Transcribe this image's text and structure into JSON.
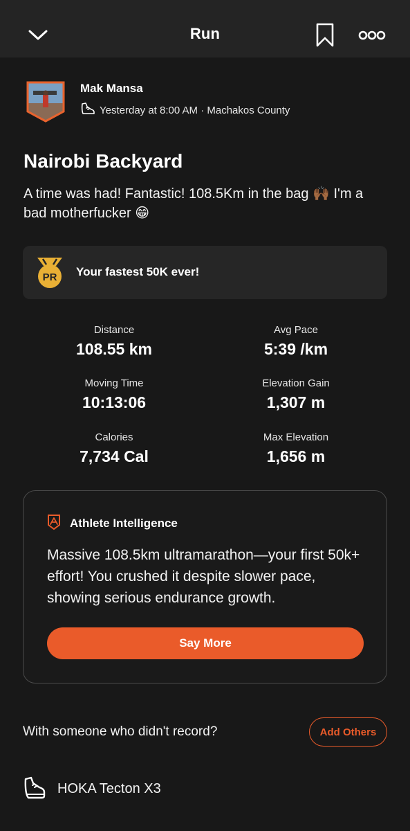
{
  "header": {
    "title": "Run",
    "back_icon": "chevron-down-icon",
    "bookmark_icon": "bookmark-icon",
    "more_icon": "more-options-icon"
  },
  "athlete": {
    "name": "Mak Mansa",
    "meta": "Yesterday at 8:00 AM · Machakos County",
    "activity_icon": "shoe-icon"
  },
  "activity": {
    "title": "Nairobi Backyard",
    "description": "A time was had! Fantastic! 108.5Km in the bag 🙌🏾 I'm a bad motherfucker 😁"
  },
  "achievement": {
    "badge": "PR",
    "text": "Your fastest 50K ever!",
    "badge_color": "#e9b035"
  },
  "stats": [
    {
      "label": "Distance",
      "value": "108.55 km"
    },
    {
      "label": "Avg Pace",
      "value": "5:39 /km"
    },
    {
      "label": "Moving Time",
      "value": "10:13:06"
    },
    {
      "label": "Elevation Gain",
      "value": "1,307 m"
    },
    {
      "label": "Calories",
      "value": "7,734 Cal"
    },
    {
      "label": "Max Elevation",
      "value": "1,656 m"
    }
  ],
  "athlete_intelligence": {
    "title": "Athlete Intelligence",
    "body": "Massive 108.5km ultramarathon—your first 50k+ effort! You crushed it despite slower pace, showing serious endurance growth.",
    "button_label": "Say More",
    "accent_color": "#ea5b2a"
  },
  "with_others": {
    "text": "With someone who didn't record?",
    "button_label": "Add Others"
  },
  "gear": {
    "name": "HOKA Tecton X3",
    "icon": "shoe-icon"
  }
}
